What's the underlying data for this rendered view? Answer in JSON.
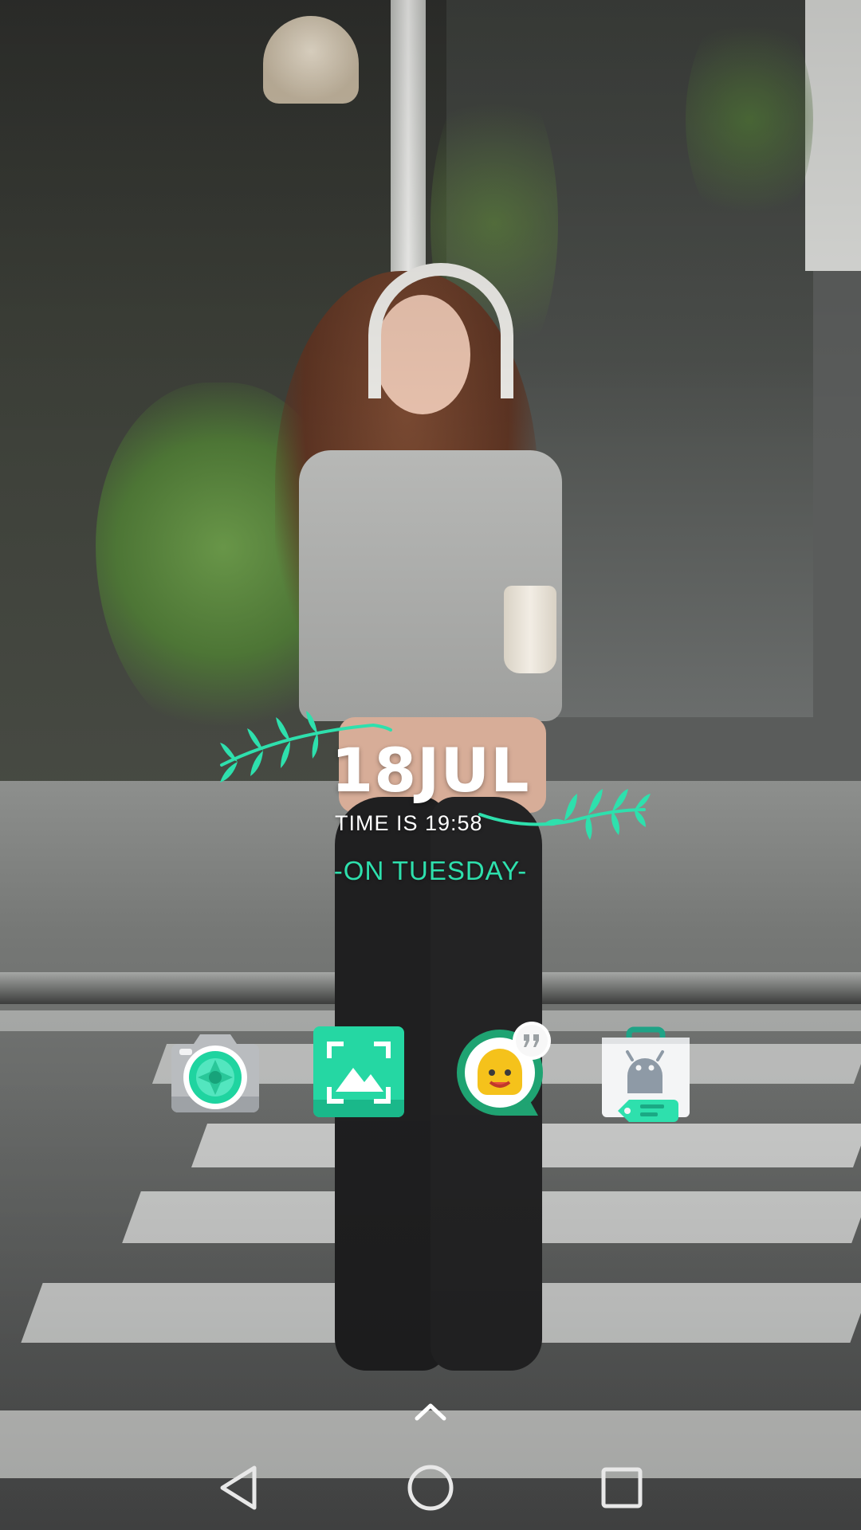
{
  "widget": {
    "date": "18JUL",
    "time": "TIME IS 19:58",
    "day": "-ON TUESDAY-",
    "accent_color": "#2ee0ad"
  },
  "dock": {
    "apps": [
      {
        "icon": "camera-icon"
      },
      {
        "icon": "screenshot-gallery-icon"
      },
      {
        "icon": "emoji-chat-icon"
      },
      {
        "icon": "android-store-icon"
      }
    ]
  },
  "drawer_handle": {
    "icon": "chevron-up-icon"
  },
  "navbar": {
    "buttons": [
      {
        "icon": "back-triangle-icon"
      },
      {
        "icon": "home-circle-icon"
      },
      {
        "icon": "recents-square-icon"
      }
    ]
  },
  "colors": {
    "accent": "#2ee0ad",
    "text": "#ffffff"
  }
}
